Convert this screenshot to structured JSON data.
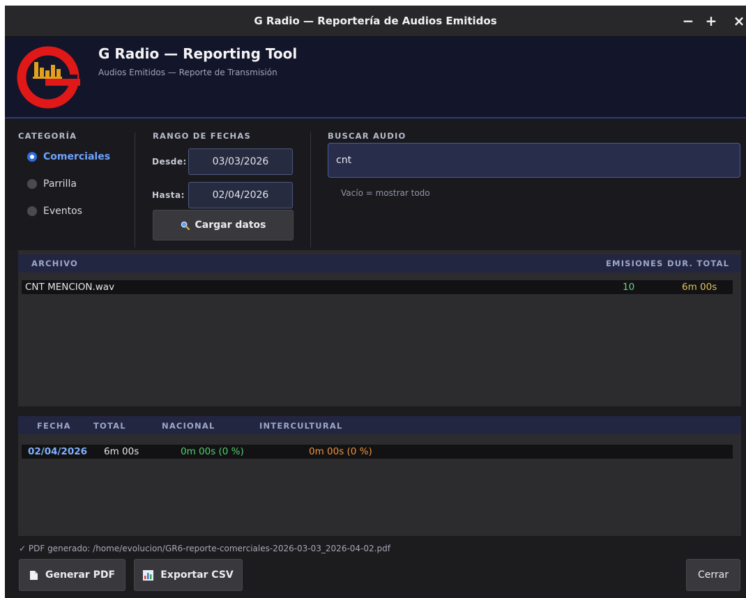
{
  "window": {
    "title": "G Radio — Reportería de Audios Emitidos",
    "minimize": "−",
    "maximize": "+",
    "close": "×"
  },
  "header": {
    "app_name": "G Radio — Reporting Tool",
    "subtitle": "Audios Emitidos — Reporte de Transmisión",
    "logo_letter": "G"
  },
  "filters": {
    "category": {
      "label": "CATEGORÍA",
      "options": [
        {
          "label": "Comerciales",
          "selected": true
        },
        {
          "label": "Parrilla",
          "selected": false
        },
        {
          "label": "Eventos",
          "selected": false
        }
      ]
    },
    "date_range": {
      "label": "RANGO DE FECHAS",
      "from_label": "Desde:",
      "from_value": "03/03/2026",
      "to_label": "Hasta:",
      "to_value": "02/04/2026",
      "load_button": "Cargar datos"
    },
    "search": {
      "label": "BUSCAR AUDIO",
      "value": "cnt",
      "hint": "Vacío = mostrar todo"
    }
  },
  "files_table": {
    "columns": [
      "ARCHIVO",
      "EMISIONES",
      "DUR. TOTAL"
    ],
    "rows": [
      {
        "file": "CNT MENCION.wav",
        "emissions": "10",
        "duration": "6m 00s"
      }
    ]
  },
  "daily_table": {
    "columns": [
      "FECHA",
      "TOTAL",
      "NACIONAL",
      "INTERCULTURAL"
    ],
    "rows": [
      {
        "date": "02/04/2026",
        "total": "6m 00s",
        "national": "0m 00s  (0 %)",
        "intercultural": "0m 00s  (0 %)"
      }
    ]
  },
  "status": "✓ PDF generado: /home/evolucion/GR6-reporte-comerciales-2026-03-03_2026-04-02.pdf",
  "actions": {
    "pdf": "Generar PDF",
    "csv": "Exportar CSV",
    "close": "Cerrar"
  },
  "colors": {
    "accent": "#2f6ee0",
    "selected_text": "#6ea3ff",
    "emissions": "#6fd08a",
    "duration": "#e2c25a",
    "national": "#4ed26c",
    "intercultural": "#f0923a",
    "logo_red": "#e01818",
    "logo_gold": "#e3a01c"
  }
}
